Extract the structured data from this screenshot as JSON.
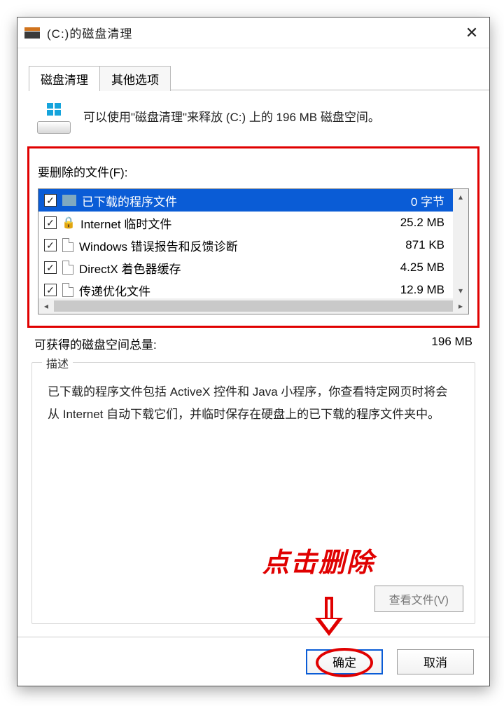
{
  "titlebar": {
    "title": "(C:)的磁盘清理"
  },
  "tabs": {
    "active": "磁盘清理",
    "inactive": "其他选项"
  },
  "intro": "可以使用\"磁盘清理\"来释放  (C:) 上的 196 MB 磁盘空间。",
  "files": {
    "label": "要删除的文件(F):",
    "items": [
      {
        "name": "已下载的程序文件",
        "size": "0 字节",
        "icon": "folder",
        "checked": true,
        "selected": true
      },
      {
        "name": "Internet 临时文件",
        "size": "25.2 MB",
        "icon": "lock",
        "checked": true,
        "selected": false
      },
      {
        "name": "Windows 错误报告和反馈诊断",
        "size": "871 KB",
        "icon": "doc",
        "checked": true,
        "selected": false
      },
      {
        "name": "DirectX 着色器缓存",
        "size": "4.25 MB",
        "icon": "doc",
        "checked": true,
        "selected": false
      },
      {
        "name": "传递优化文件",
        "size": "12.9 MB",
        "icon": "doc",
        "checked": true,
        "selected": false
      }
    ]
  },
  "total": {
    "label": "可获得的磁盘空间总量:",
    "value": "196 MB"
  },
  "description": {
    "legend": "描述",
    "text": "已下载的程序文件包括 ActiveX 控件和 Java 小程序，你查看特定网页时将会从 Internet 自动下载它们，并临时保存在硬盘上的已下载的程序文件夹中。",
    "view_button": "查看文件(V)"
  },
  "buttons": {
    "ok": "确定",
    "cancel": "取消"
  },
  "annotation": {
    "text": "点击删除"
  }
}
